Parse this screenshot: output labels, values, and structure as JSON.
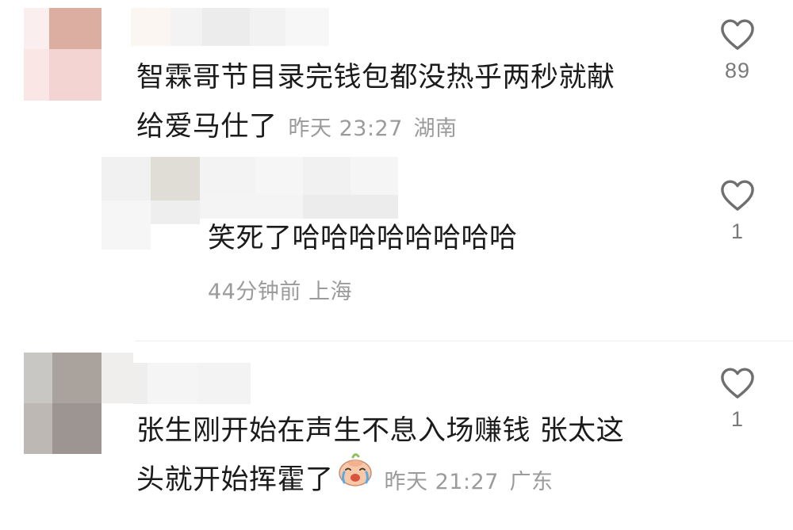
{
  "comments": [
    {
      "text_line1": "智霖哥节目录完钱包都没热乎两秒就献",
      "text_line2": "给爱马仕了",
      "time": "昨天 23:27",
      "location": "湖南",
      "likes": "89"
    },
    {
      "text": "笑死了哈哈哈哈哈哈哈哈",
      "time": "44分钟前",
      "location": "上海",
      "likes": "1"
    },
    {
      "text_line1": "张生刚开始在声生不息入场赚钱 张太这",
      "text_line2": "头就开始挥霍了",
      "emoji": "crying-emoji",
      "time": "昨天 21:27",
      "location": "广东",
      "likes": "1"
    }
  ],
  "icons": {
    "like": "heart-outline-icon"
  },
  "colors": {
    "text": "#1b1b1b",
    "meta": "#9b9b9b",
    "icon": "#6f6f6f"
  }
}
